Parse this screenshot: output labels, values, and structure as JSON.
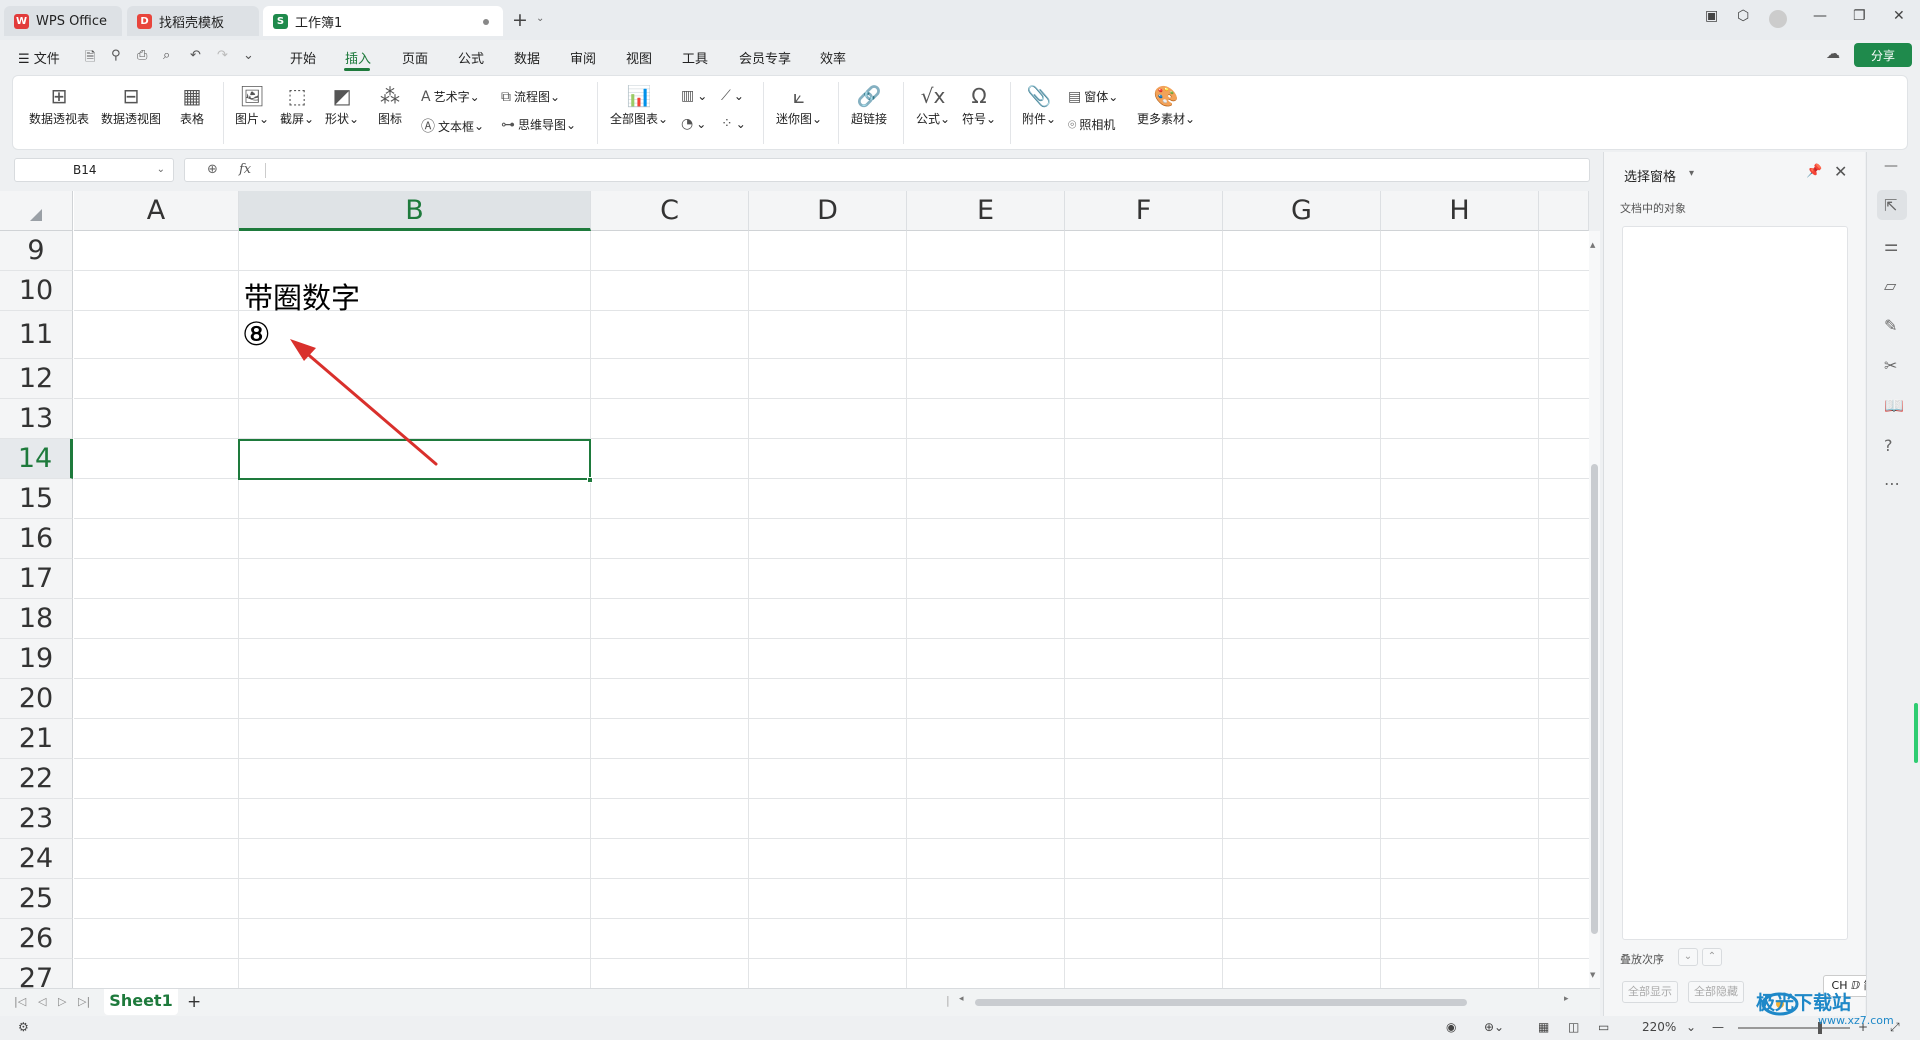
{
  "titlebar": {
    "tabs": [
      {
        "label": "WPS Office"
      },
      {
        "label": "找稻壳模板"
      },
      {
        "label": "工作簿1"
      }
    ],
    "new_tab": "+"
  },
  "menu": {
    "file": "☰ 文件",
    "items": [
      "开始",
      "插入",
      "页面",
      "公式",
      "数据",
      "审阅",
      "视图",
      "工具",
      "会员专享",
      "效率"
    ],
    "share": "分享"
  },
  "ribbon": {
    "pivot_table": "数据透视表",
    "pivot_chart": "数据透视图",
    "table": "表格",
    "picture": "图片",
    "screenshot": "截屏",
    "shape": "形状",
    "icon": "图标",
    "wordart": "艺术字",
    "textbox": "文本框",
    "flowchart": "流程图",
    "mindmap": "思维导图",
    "all_charts": "全部图表",
    "sparkline": "迷你图",
    "hyperlink": "超链接",
    "formula": "公式",
    "symbol": "符号",
    "attachment": "附件",
    "form": "窗体",
    "camera": "照相机",
    "more_assets": "更多素材"
  },
  "formula_bar": {
    "name_box": "B14",
    "fx": "fx",
    "value": ""
  },
  "grid": {
    "columns": [
      "A",
      "B",
      "C",
      "D",
      "E",
      "F",
      "G",
      "H"
    ],
    "selected_column": "B",
    "rows": [
      "9",
      "10",
      "11",
      "12",
      "13",
      "14",
      "15",
      "16",
      "17",
      "18",
      "19",
      "20",
      "21",
      "22",
      "23",
      "24",
      "25",
      "26",
      "27"
    ],
    "selected_row": "14",
    "cells": {
      "B10": "带圈数字",
      "B11": "⑧"
    },
    "arrow_color": "#d9302c",
    "accent": "#1e7a3c"
  },
  "sheets": {
    "tabs": [
      "Sheet1"
    ],
    "add": "+"
  },
  "status": {
    "zoom": "220%",
    "minus": "—",
    "plus": "+"
  },
  "pane": {
    "title": "选择窗格",
    "subtitle": "文档中的对象",
    "order_label": "叠放次序",
    "show_all": "全部显示",
    "hide_all": "全部隐藏",
    "ime": "CH ⅅ 简"
  },
  "watermark": {
    "text": "极光下载站",
    "url": "www.xz7.com"
  }
}
